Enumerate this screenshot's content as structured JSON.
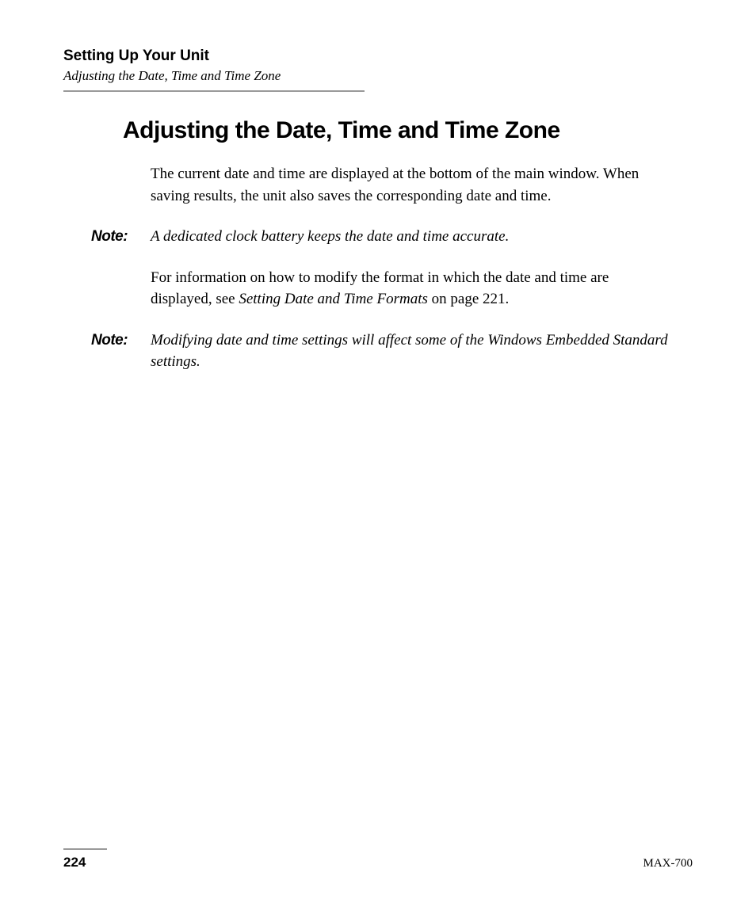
{
  "header": {
    "chapter": "Setting Up Your Unit",
    "section": "Adjusting the Date, Time and Time Zone"
  },
  "heading": "Adjusting the Date, Time and Time Zone",
  "para1": "The current date and time are displayed at the bottom of the main window. When saving results, the unit also saves the corresponding date and time.",
  "note1": {
    "label": "Note:",
    "text": "A dedicated clock battery keeps the date and time accurate."
  },
  "para2_pre": "For information on how to modify the format in which the date and time are displayed, see ",
  "para2_ref": "Setting Date and Time Formats",
  "para2_post": " on page 221.",
  "note2": {
    "label": "Note:",
    "text": "Modifying date and time settings will affect some of the Windows Embedded Standard settings."
  },
  "footer": {
    "page": "224",
    "product": "MAX-700"
  }
}
